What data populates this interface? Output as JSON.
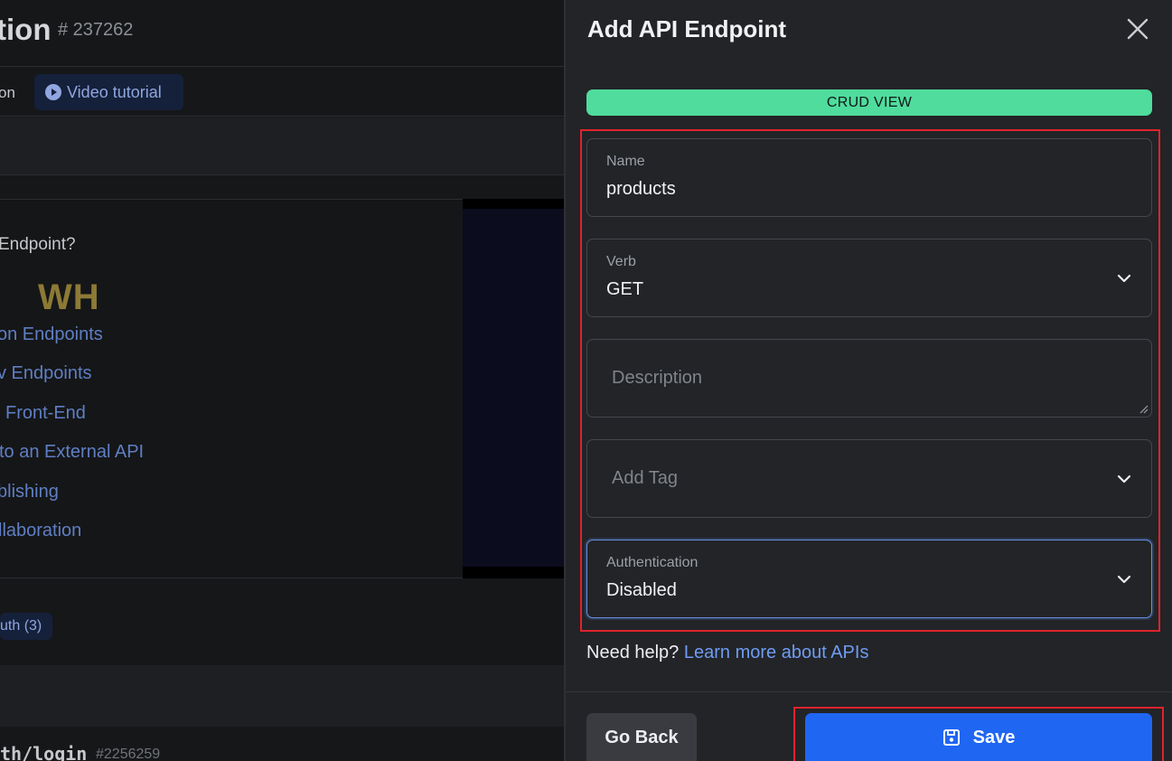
{
  "background": {
    "title_fragment": "tion",
    "endpoint_id": "# 237262",
    "tab_fragment": "on",
    "video_tutorial_label": "Video tutorial",
    "question_fragment": "Endpoint?",
    "links": [
      "on Endpoints",
      "v Endpoints",
      "Front-End",
      "to an External API",
      "blishing",
      "llaboration"
    ],
    "video_overlay_text": "WH",
    "auth_badge": "uth (3)",
    "login_fragment": "th/login",
    "login_id": "#2256259"
  },
  "drawer": {
    "title": "Add API Endpoint",
    "mode_badge": "CRUD VIEW",
    "fields": {
      "name": {
        "label": "Name",
        "value": "products"
      },
      "verb": {
        "label": "Verb",
        "value": "GET"
      },
      "description": {
        "placeholder": "Description"
      },
      "tag": {
        "placeholder": "Add Tag"
      },
      "authentication": {
        "label": "Authentication",
        "value": "Disabled"
      }
    },
    "help_prefix": "Need help?",
    "help_link": "Learn more about APIs",
    "go_back_label": "Go Back",
    "save_label": "Save"
  },
  "colors": {
    "accent": "#1f66f2",
    "badge": "#4fdc9c",
    "highlight": "#e0222d",
    "link": "#6f9cf3"
  }
}
